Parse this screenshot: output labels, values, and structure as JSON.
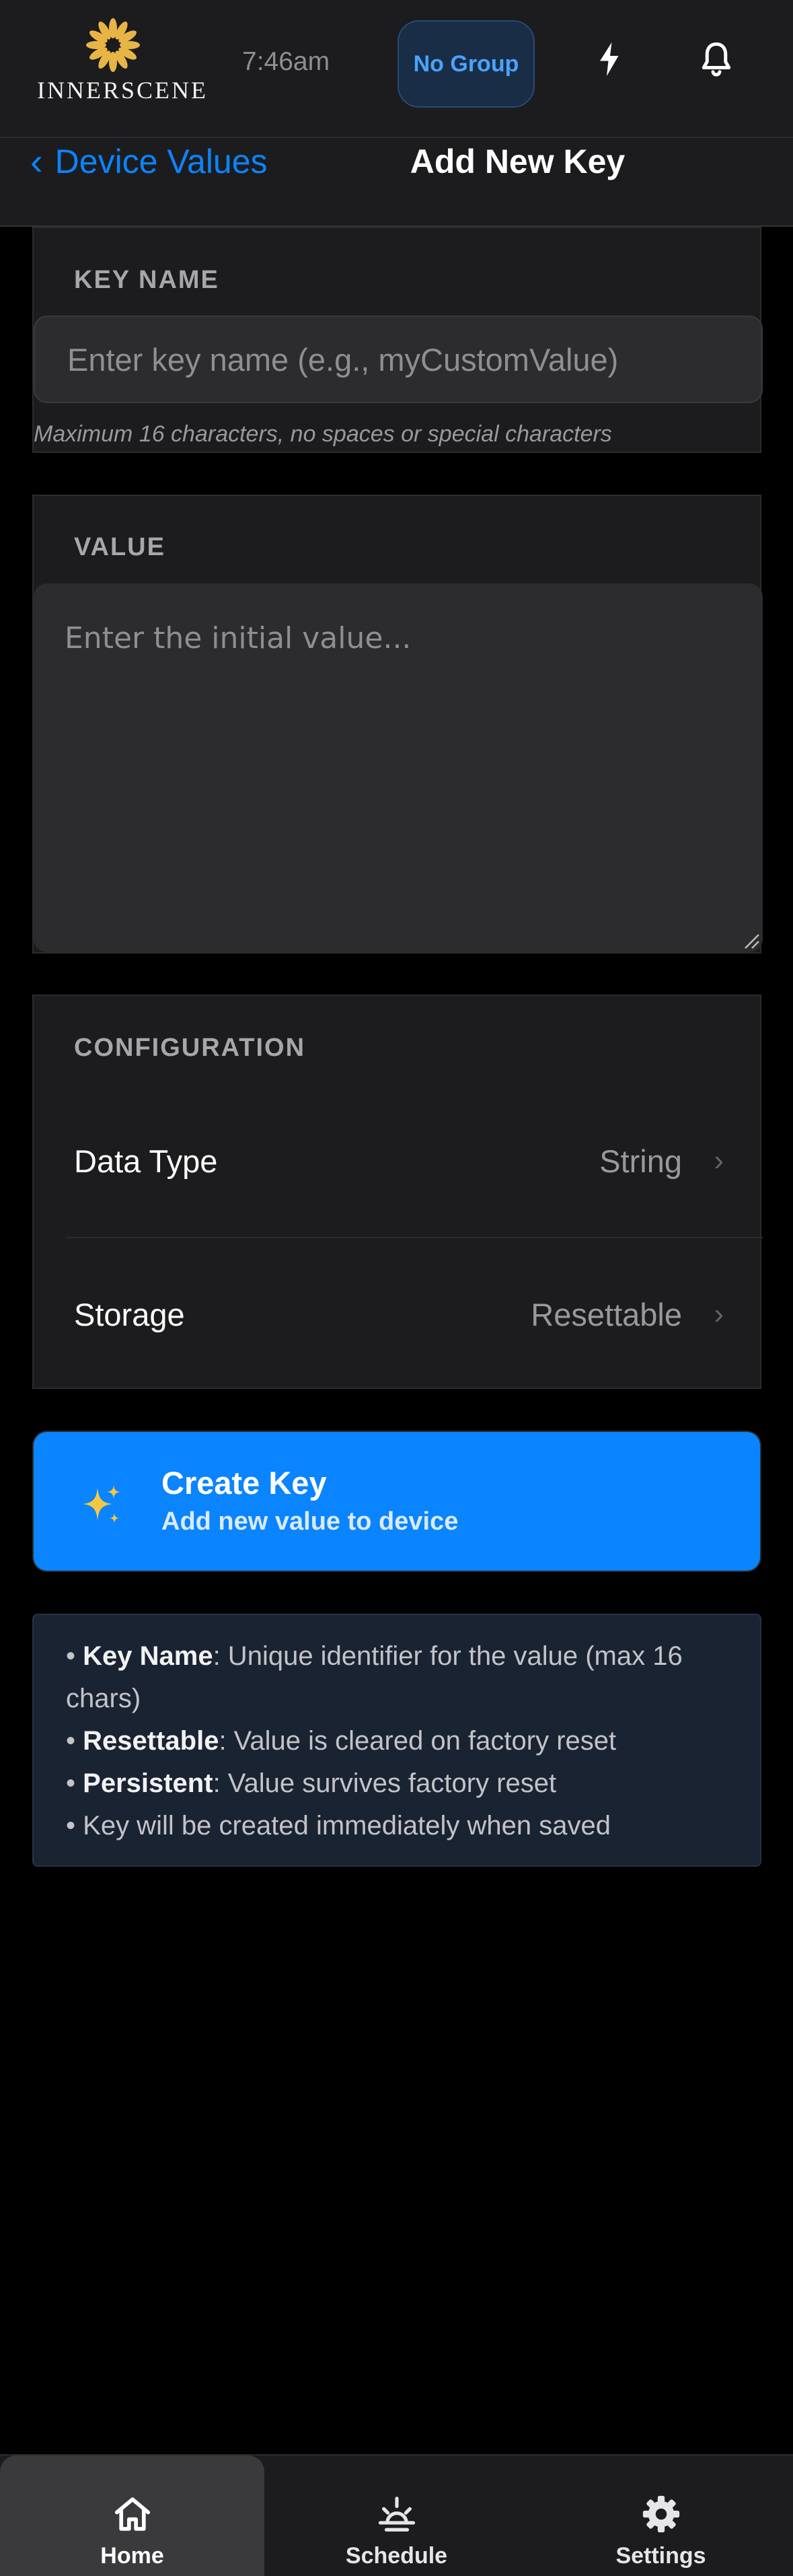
{
  "header": {
    "logo_text": "INNERSCENE",
    "time": "7:46am",
    "group_label": "No Group",
    "icons": [
      "flash-icon",
      "bell-icon"
    ]
  },
  "nav": {
    "back_chevron": "‹",
    "back_label": "Device Values",
    "title": "Add New Key"
  },
  "key_name": {
    "section_title": "KEY NAME",
    "placeholder": "Enter key name (e.g., myCustomValue)",
    "hint": "Maximum 16 characters, no spaces or special characters"
  },
  "value": {
    "section_title": "VALUE",
    "placeholder": "Enter the initial value..."
  },
  "configuration": {
    "section_title": "CONFIGURATION",
    "rows": [
      {
        "label": "Data Type",
        "value": "String",
        "arrow": "›"
      },
      {
        "label": "Storage",
        "value": "Resettable",
        "arrow": "›"
      }
    ]
  },
  "create_button": {
    "icon": "sparkle-icon",
    "title": "Create Key",
    "subtitle": "Add new value to device"
  },
  "info": {
    "bullet": "•",
    "items": [
      {
        "term": "Key Name",
        "text": ": Unique identifier for the value (max 16 chars)"
      },
      {
        "term": "Resettable",
        "text": ": Value is cleared on factory reset"
      },
      {
        "term": "Persistent",
        "text": ": Value survives factory reset"
      },
      {
        "term": "",
        "text": "Key will be created immediately when saved"
      }
    ]
  },
  "tabs": [
    {
      "label": "Home",
      "icon": "home-icon",
      "active": true
    },
    {
      "label": "Schedule",
      "icon": "sunrise-icon",
      "active": false
    },
    {
      "label": "Settings",
      "icon": "gear-icon",
      "active": false
    }
  ],
  "colors": {
    "accent": "#0a84ff",
    "background": "#000000",
    "card": "#1c1c1e",
    "logo_gold": "#e8b545"
  }
}
